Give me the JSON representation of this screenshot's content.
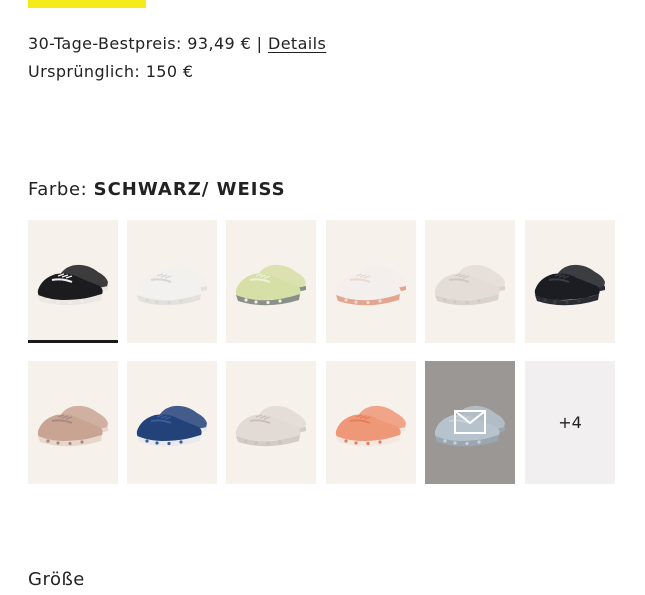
{
  "pricing": {
    "best_price_label": "30-Tage-Bestpreis: 93,49 € |",
    "details_link": "Details",
    "original_price": "Ursprünglich: 150 €"
  },
  "color_selector": {
    "label": "Farbe:",
    "selected_value": "SCHWARZ/ WEISS",
    "swatches": [
      {
        "variant": "black-white",
        "upper": "#1c1c1e",
        "sole": "#e9e6e3",
        "accent": "#f1efed",
        "selected": true
      },
      {
        "variant": "white",
        "upper": "#f2f1ef",
        "sole": "#e3e1de",
        "accent": "#d9d7d4"
      },
      {
        "variant": "lime-grey",
        "upper": "#d6dfa6",
        "sole": "#8b8f8a",
        "accent": "#eef1d8"
      },
      {
        "variant": "white-coral",
        "upper": "#f3efec",
        "sole": "#e4a58f",
        "accent": "#e9d9d2"
      },
      {
        "variant": "sand-grey",
        "upper": "#e4ddd7",
        "sole": "#d8d3ce",
        "accent": "#cfc8c2"
      },
      {
        "variant": "all-black",
        "upper": "#1b1d22",
        "sole": "#2a2c31",
        "accent": "#3a3d44"
      },
      {
        "variant": "rose-mauve",
        "upper": "#c9a493",
        "sole": "#e7d6cc",
        "accent": "#a88a82"
      },
      {
        "variant": "navy-blue",
        "upper": "#23427a",
        "sole": "#e9eaee",
        "accent": "#3a5c9a"
      },
      {
        "variant": "pearl",
        "upper": "#e2dbd5",
        "sole": "#d3ccc6",
        "accent": "#c8c0b9"
      },
      {
        "variant": "coral",
        "upper": "#ef9877",
        "sole": "#f3e7df",
        "accent": "#e77e5b"
      },
      {
        "variant": "blue-grey-notify",
        "upper": "#b6c2cc",
        "sole": "#9aa7b2",
        "accent": "#c8d1d8",
        "icon": "mail-icon"
      }
    ],
    "more_label": "+4"
  },
  "size_section": {
    "heading": "Größe"
  },
  "colors": {
    "accent_yellow": "#f5ea1a",
    "swatch_bg": "#f7f1ec",
    "notify_bg": "#9a9794",
    "selected_bar": "#1a1a1a"
  }
}
